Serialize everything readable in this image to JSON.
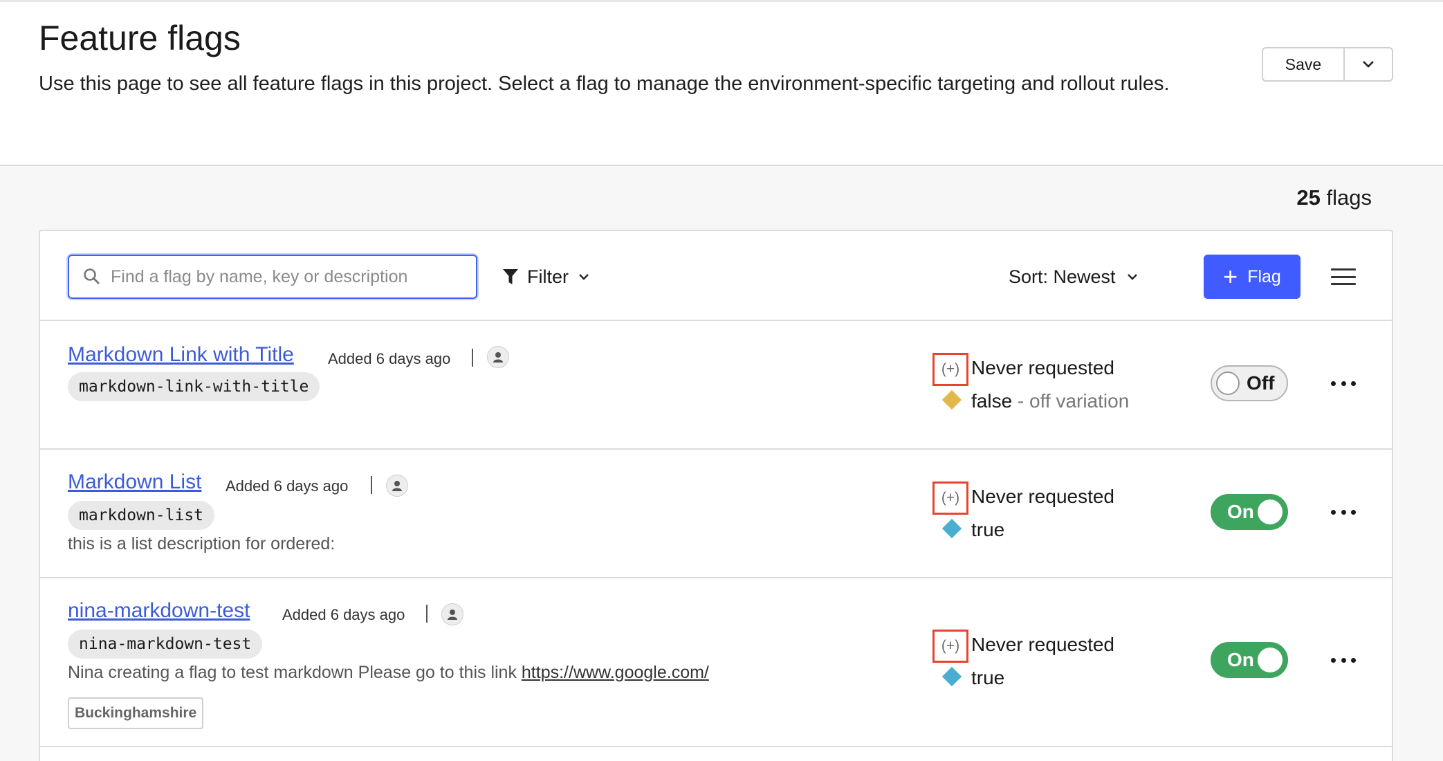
{
  "header": {
    "title": "Feature flags",
    "description": "Use this page to see all feature flags in this project. Select a flag to manage the environment-specific targeting and rollout rules.",
    "save_label": "Save"
  },
  "flag_count": {
    "number": "25",
    "label": "flags"
  },
  "toolbar": {
    "search_placeholder": "Find a flag by name, key or description",
    "filter_label": "Filter",
    "sort_label": "Sort: Newest",
    "add_flag_label": "Flag"
  },
  "flags": [
    {
      "name": "Markdown Link with Title",
      "added": "Added 6 days ago",
      "key": "markdown-link-with-title",
      "plus": "(+)",
      "status": "Never requested",
      "variation_value": "false",
      "variation_suffix": " - off variation",
      "variation_color": "#e2b84d",
      "toggle": "Off"
    },
    {
      "name": "Markdown List",
      "added": "Added 6 days ago",
      "key": "markdown-list",
      "description": "this is a list description for ordered:",
      "plus": "(+)",
      "status": "Never requested",
      "variation_value": "true",
      "variation_color": "#4aaed0",
      "toggle": "On"
    },
    {
      "name": "nina-markdown-test",
      "added": "Added 6 days ago",
      "key": "nina-markdown-test",
      "description": "Nina creating a flag to test markdown Please go to this link ",
      "description_link": "https://www.google.com/",
      "tag": "Buckinghamshire",
      "plus": "(+)",
      "status": "Never requested",
      "variation_value": "true",
      "variation_color": "#4aaed0",
      "toggle": "On"
    }
  ]
}
